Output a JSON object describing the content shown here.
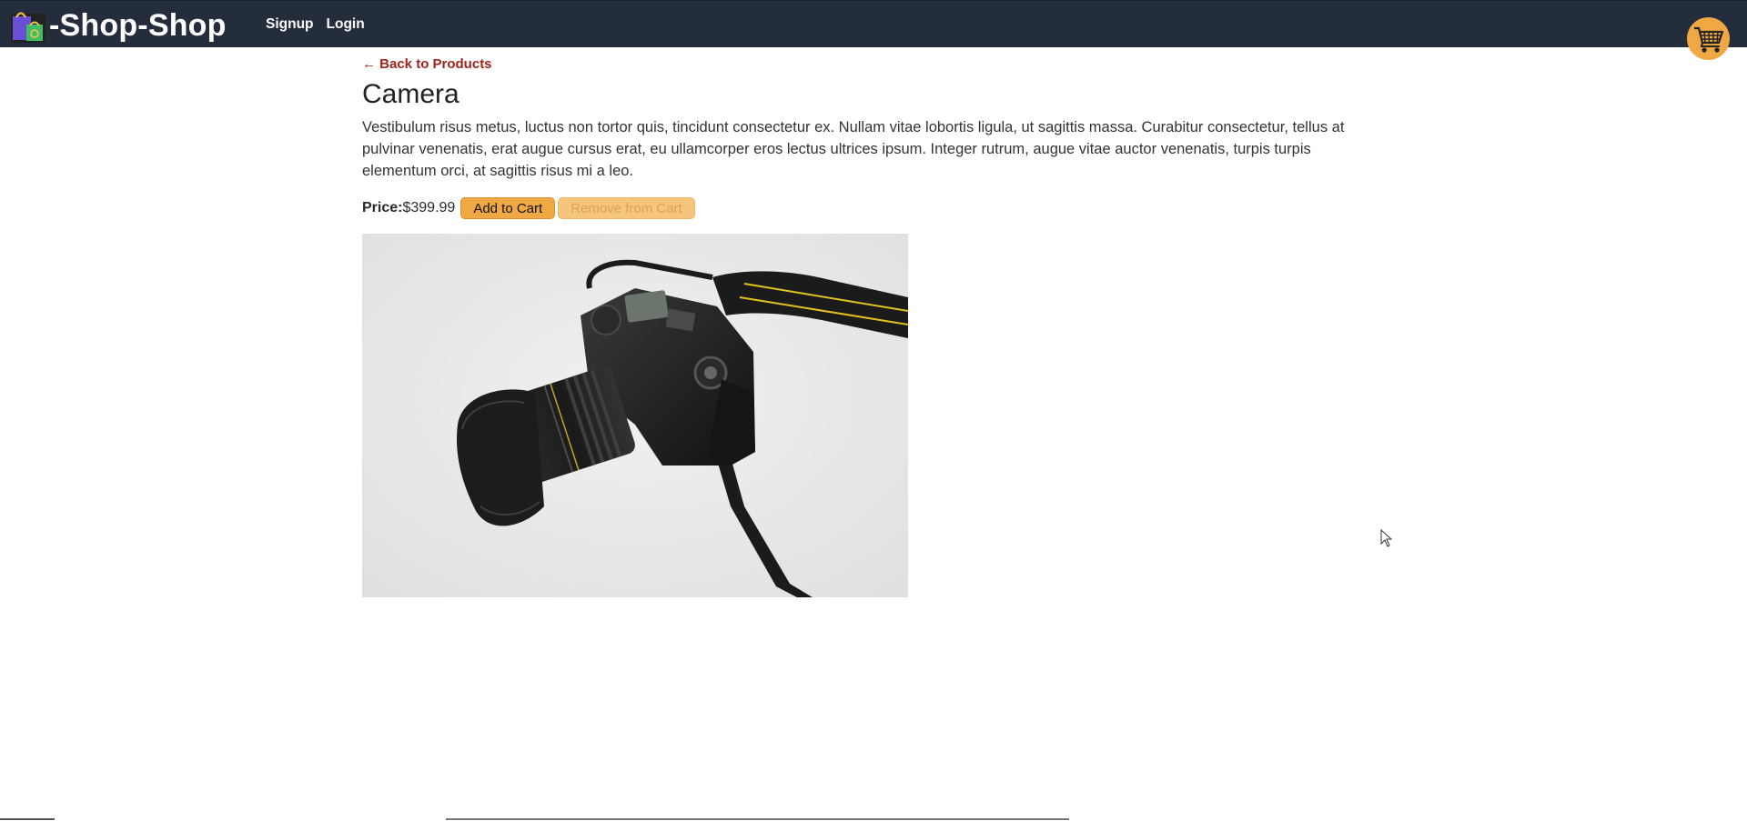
{
  "nav": {
    "brand": "-Shop-Shop",
    "links": [
      "Signup",
      "Login"
    ],
    "cart_icon": "shopping-cart-icon"
  },
  "product": {
    "back_link": "← Back to Products",
    "title": "Camera",
    "description": "Vestibulum risus metus, luctus non tortor quis, tincidunt consectetur ex. Nullam vitae lobortis ligula, ut sagittis massa. Curabitur consectetur, tellus at pulvinar venenatis, erat augue cursus erat, eu ullamcorper eros lectus ultrices ipsum. Integer rutrum, augue vitae auctor venenatis, turpis turpis elementum orci, at sagittis risus mi a leo.",
    "price_label": "Price:",
    "price": "$399.99",
    "add_button": "Add to Cart",
    "remove_button": "Remove from Cart",
    "image_icon": "camera-photo"
  },
  "colors": {
    "navbar": "#242d3b",
    "accent": "#f0a844",
    "back_link": "#a1241a"
  }
}
